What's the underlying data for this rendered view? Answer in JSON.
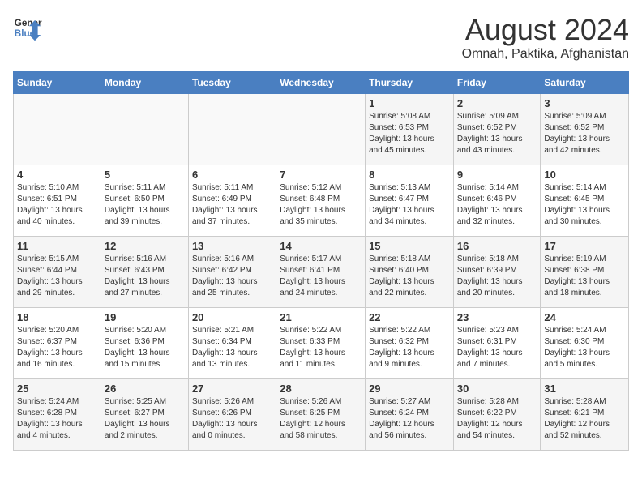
{
  "header": {
    "logo_line1": "General",
    "logo_line2": "Blue",
    "month_year": "August 2024",
    "location": "Omnah, Paktika, Afghanistan"
  },
  "weekdays": [
    "Sunday",
    "Monday",
    "Tuesday",
    "Wednesday",
    "Thursday",
    "Friday",
    "Saturday"
  ],
  "weeks": [
    [
      {
        "day": "",
        "info": ""
      },
      {
        "day": "",
        "info": ""
      },
      {
        "day": "",
        "info": ""
      },
      {
        "day": "",
        "info": ""
      },
      {
        "day": "1",
        "info": "Sunrise: 5:08 AM\nSunset: 6:53 PM\nDaylight: 13 hours\nand 45 minutes."
      },
      {
        "day": "2",
        "info": "Sunrise: 5:09 AM\nSunset: 6:52 PM\nDaylight: 13 hours\nand 43 minutes."
      },
      {
        "day": "3",
        "info": "Sunrise: 5:09 AM\nSunset: 6:52 PM\nDaylight: 13 hours\nand 42 minutes."
      }
    ],
    [
      {
        "day": "4",
        "info": "Sunrise: 5:10 AM\nSunset: 6:51 PM\nDaylight: 13 hours\nand 40 minutes."
      },
      {
        "day": "5",
        "info": "Sunrise: 5:11 AM\nSunset: 6:50 PM\nDaylight: 13 hours\nand 39 minutes."
      },
      {
        "day": "6",
        "info": "Sunrise: 5:11 AM\nSunset: 6:49 PM\nDaylight: 13 hours\nand 37 minutes."
      },
      {
        "day": "7",
        "info": "Sunrise: 5:12 AM\nSunset: 6:48 PM\nDaylight: 13 hours\nand 35 minutes."
      },
      {
        "day": "8",
        "info": "Sunrise: 5:13 AM\nSunset: 6:47 PM\nDaylight: 13 hours\nand 34 minutes."
      },
      {
        "day": "9",
        "info": "Sunrise: 5:14 AM\nSunset: 6:46 PM\nDaylight: 13 hours\nand 32 minutes."
      },
      {
        "day": "10",
        "info": "Sunrise: 5:14 AM\nSunset: 6:45 PM\nDaylight: 13 hours\nand 30 minutes."
      }
    ],
    [
      {
        "day": "11",
        "info": "Sunrise: 5:15 AM\nSunset: 6:44 PM\nDaylight: 13 hours\nand 29 minutes."
      },
      {
        "day": "12",
        "info": "Sunrise: 5:16 AM\nSunset: 6:43 PM\nDaylight: 13 hours\nand 27 minutes."
      },
      {
        "day": "13",
        "info": "Sunrise: 5:16 AM\nSunset: 6:42 PM\nDaylight: 13 hours\nand 25 minutes."
      },
      {
        "day": "14",
        "info": "Sunrise: 5:17 AM\nSunset: 6:41 PM\nDaylight: 13 hours\nand 24 minutes."
      },
      {
        "day": "15",
        "info": "Sunrise: 5:18 AM\nSunset: 6:40 PM\nDaylight: 13 hours\nand 22 minutes."
      },
      {
        "day": "16",
        "info": "Sunrise: 5:18 AM\nSunset: 6:39 PM\nDaylight: 13 hours\nand 20 minutes."
      },
      {
        "day": "17",
        "info": "Sunrise: 5:19 AM\nSunset: 6:38 PM\nDaylight: 13 hours\nand 18 minutes."
      }
    ],
    [
      {
        "day": "18",
        "info": "Sunrise: 5:20 AM\nSunset: 6:37 PM\nDaylight: 13 hours\nand 16 minutes."
      },
      {
        "day": "19",
        "info": "Sunrise: 5:20 AM\nSunset: 6:36 PM\nDaylight: 13 hours\nand 15 minutes."
      },
      {
        "day": "20",
        "info": "Sunrise: 5:21 AM\nSunset: 6:34 PM\nDaylight: 13 hours\nand 13 minutes."
      },
      {
        "day": "21",
        "info": "Sunrise: 5:22 AM\nSunset: 6:33 PM\nDaylight: 13 hours\nand 11 minutes."
      },
      {
        "day": "22",
        "info": "Sunrise: 5:22 AM\nSunset: 6:32 PM\nDaylight: 13 hours\nand 9 minutes."
      },
      {
        "day": "23",
        "info": "Sunrise: 5:23 AM\nSunset: 6:31 PM\nDaylight: 13 hours\nand 7 minutes."
      },
      {
        "day": "24",
        "info": "Sunrise: 5:24 AM\nSunset: 6:30 PM\nDaylight: 13 hours\nand 5 minutes."
      }
    ],
    [
      {
        "day": "25",
        "info": "Sunrise: 5:24 AM\nSunset: 6:28 PM\nDaylight: 13 hours\nand 4 minutes."
      },
      {
        "day": "26",
        "info": "Sunrise: 5:25 AM\nSunset: 6:27 PM\nDaylight: 13 hours\nand 2 minutes."
      },
      {
        "day": "27",
        "info": "Sunrise: 5:26 AM\nSunset: 6:26 PM\nDaylight: 13 hours\nand 0 minutes."
      },
      {
        "day": "28",
        "info": "Sunrise: 5:26 AM\nSunset: 6:25 PM\nDaylight: 12 hours\nand 58 minutes."
      },
      {
        "day": "29",
        "info": "Sunrise: 5:27 AM\nSunset: 6:24 PM\nDaylight: 12 hours\nand 56 minutes."
      },
      {
        "day": "30",
        "info": "Sunrise: 5:28 AM\nSunset: 6:22 PM\nDaylight: 12 hours\nand 54 minutes."
      },
      {
        "day": "31",
        "info": "Sunrise: 5:28 AM\nSunset: 6:21 PM\nDaylight: 12 hours\nand 52 minutes."
      }
    ]
  ]
}
